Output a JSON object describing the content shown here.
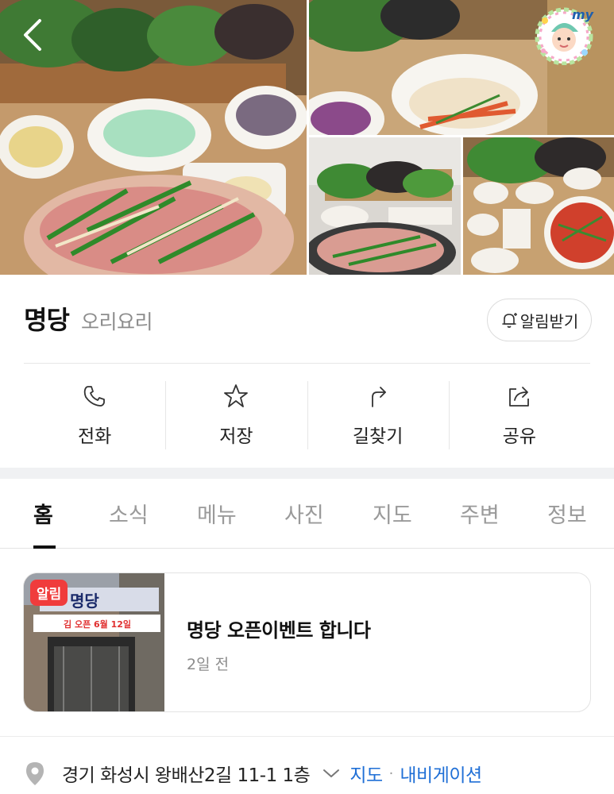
{
  "place": {
    "name": "명당",
    "category": "오리요리",
    "alarm_label": "알림받기"
  },
  "actions": [
    {
      "label": "전화",
      "icon": "phone-icon"
    },
    {
      "label": "저장",
      "icon": "star-icon"
    },
    {
      "label": "길찾기",
      "icon": "directions-icon"
    },
    {
      "label": "공유",
      "icon": "share-icon"
    }
  ],
  "tabs": [
    "홈",
    "소식",
    "메뉴",
    "사진",
    "지도",
    "주변",
    "정보"
  ],
  "active_tab": "홈",
  "notice": {
    "badge": "알림",
    "title": "명당 오픈이벤트 합니다",
    "time": "2일 전",
    "thumb_sign": "명당",
    "thumb_banner": "김 오픈 6월 12일"
  },
  "address": {
    "text": "경기 화성시 왕배산2길 11-1 1층",
    "map_link": "지도",
    "nav_link": "내비게이션"
  },
  "profile": {
    "label": "my"
  },
  "colors": {
    "accent_link": "#1f6fd6",
    "badge_red": "#f03c3c",
    "band_gray": "#f0f1f3"
  }
}
